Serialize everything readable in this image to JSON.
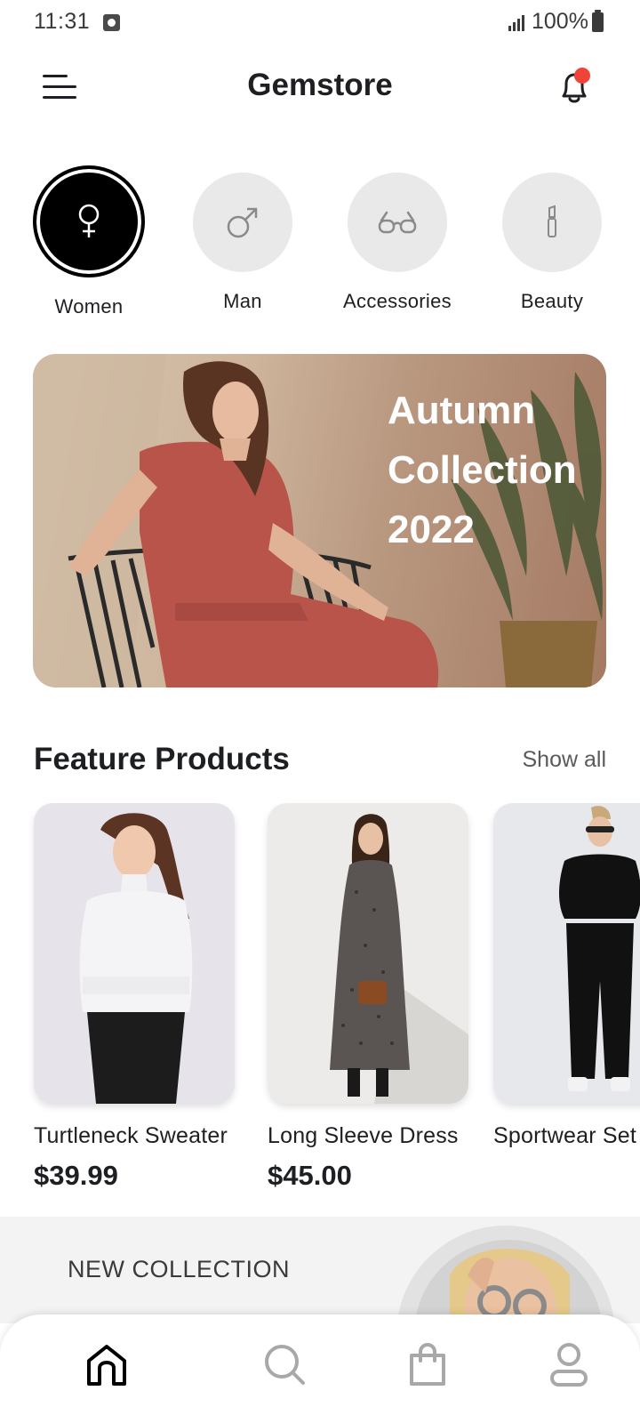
{
  "status_bar": {
    "time": "11:31",
    "battery": "100%"
  },
  "header": {
    "title": "Gemstore",
    "menu_icon": "hamburger-menu-icon",
    "notification_icon": "bell-icon",
    "notification_dot_color": "#f04438"
  },
  "categories": [
    {
      "label": "Women",
      "icon": "female-symbol-icon",
      "active": true
    },
    {
      "label": "Man",
      "icon": "male-symbol-icon",
      "active": false
    },
    {
      "label": "Accessories",
      "icon": "glasses-icon",
      "active": false
    },
    {
      "label": "Beauty",
      "icon": "lipstick-icon",
      "active": false
    }
  ],
  "banner": {
    "title": "Autumn Collection 2022"
  },
  "feature_products": {
    "title": "Feature Products",
    "show_all": "Show all",
    "items": [
      {
        "name": "Turtleneck Sweater",
        "price": "$39.99"
      },
      {
        "name": "Long Sleeve Dress",
        "price": "$45.00"
      },
      {
        "name": "Sportwear Set",
        "price": ""
      }
    ]
  },
  "new_collection": {
    "label": "NEW COLLECTION"
  },
  "bottom_nav": [
    {
      "icon": "home-icon",
      "active": true
    },
    {
      "icon": "search-icon",
      "active": false
    },
    {
      "icon": "shopping-bag-icon",
      "active": false
    },
    {
      "icon": "profile-icon",
      "active": false
    }
  ],
  "colors": {
    "accent": "#000000",
    "inactive_circle": "#e9e9e9",
    "inactive_icon": "#a8a8a8",
    "text": "#1d1f22"
  }
}
